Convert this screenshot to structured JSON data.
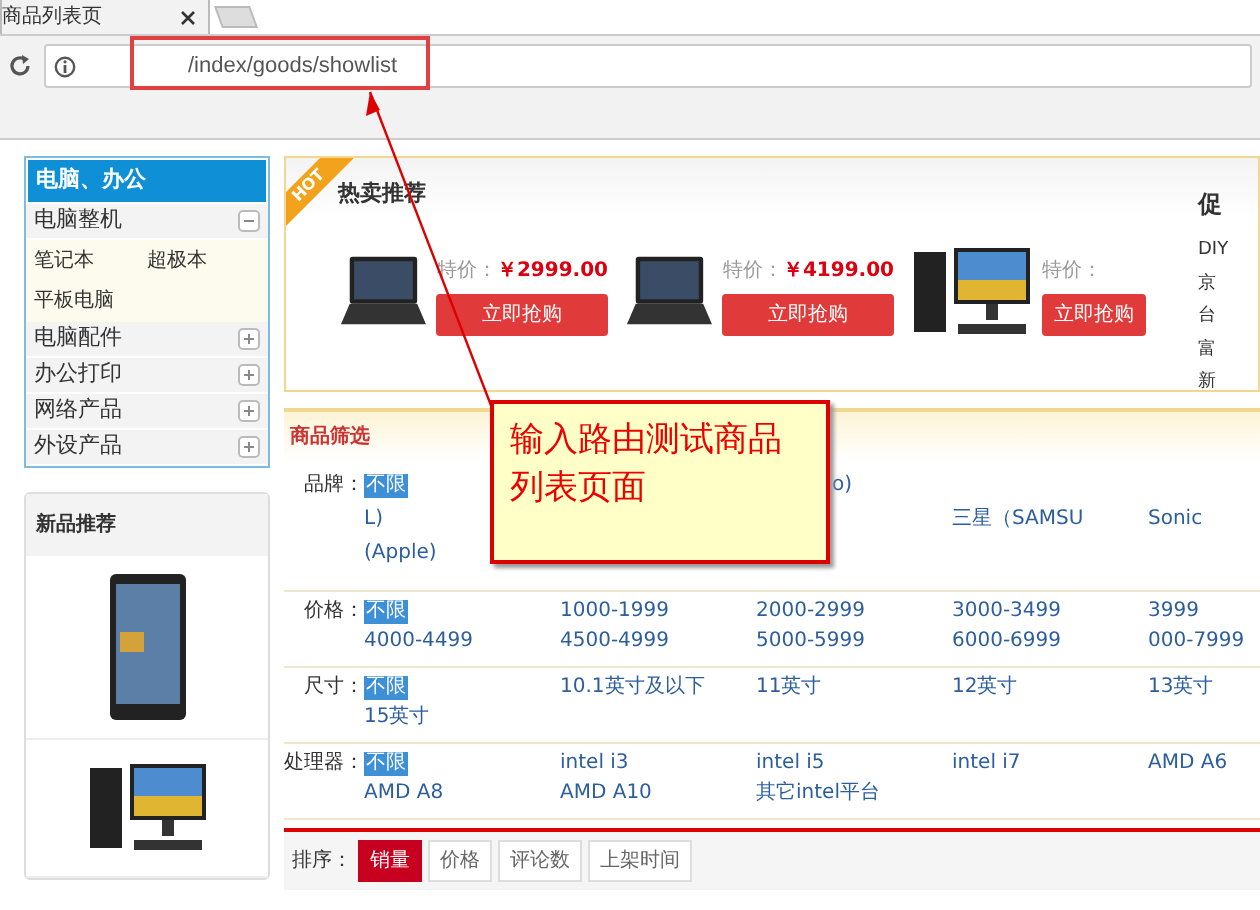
{
  "browser": {
    "tab_title": "商品列表页",
    "url": "/index/goods/showlist"
  },
  "annotation": {
    "text": "输入路由测试商品列表页面"
  },
  "sidebar": {
    "header": "电脑、办公",
    "categories": [
      {
        "label": "电脑整机",
        "expanded": true,
        "children": [
          "笔记本",
          "超极本",
          "平板电脑"
        ]
      },
      {
        "label": "电脑配件",
        "expanded": false
      },
      {
        "label": "办公打印",
        "expanded": false
      },
      {
        "label": "网络产品",
        "expanded": false
      },
      {
        "label": "外设产品",
        "expanded": false
      }
    ],
    "new_products": {
      "title": "新品推荐",
      "items": [
        {
          "kind": "tablet"
        },
        {
          "kind": "desktop"
        }
      ]
    }
  },
  "hot": {
    "badge": "HOT",
    "title": "热卖推荐",
    "products": [
      {
        "kind": "laptop",
        "price_label": "特价：",
        "price": "￥2999.00",
        "button": "立即抢购"
      },
      {
        "kind": "laptop",
        "price_label": "特价：",
        "price": "￥4199.00",
        "button": "立即抢购"
      },
      {
        "kind": "desktop",
        "price_label": "特价：",
        "button": "立即抢购"
      }
    ],
    "promo": {
      "title": "促",
      "items": [
        "DIY",
        "京",
        "台",
        "富",
        "新"
      ]
    }
  },
  "filter": {
    "title": "商品筛选",
    "rows": [
      {
        "label": "品牌：",
        "options": [
          {
            "text": "不限",
            "selected": true
          },
          {
            "text": "L)",
            "selected": false
          },
          {
            "text": "(Apple)",
            "selected": false
          },
          {
            "text": "o)",
            "selected": false
          },
          {
            "text": "三星（SAMSU",
            "selected": false
          },
          {
            "text": "Sonic",
            "selected": false
          }
        ]
      },
      {
        "label": "价格：",
        "options": [
          {
            "text": "不限",
            "selected": true
          },
          {
            "text": "1000-1999",
            "selected": false
          },
          {
            "text": "2000-2999",
            "selected": false
          },
          {
            "text": "3000-3499",
            "selected": false
          },
          {
            "text": "3999",
            "selected": false
          },
          {
            "text": "4000-4499",
            "selected": false
          },
          {
            "text": "4500-4999",
            "selected": false
          },
          {
            "text": "5000-5999",
            "selected": false
          },
          {
            "text": "6000-6999",
            "selected": false
          },
          {
            "text": "000-7999",
            "selected": false
          }
        ]
      },
      {
        "label": "尺寸：",
        "options": [
          {
            "text": "不限",
            "selected": true
          },
          {
            "text": "10.1英寸及以下",
            "selected": false
          },
          {
            "text": "11英寸",
            "selected": false
          },
          {
            "text": "12英寸",
            "selected": false
          },
          {
            "text": "13英寸",
            "selected": false
          },
          {
            "text": "15英寸",
            "selected": false
          }
        ]
      },
      {
        "label": "处理器：",
        "options": [
          {
            "text": "不限",
            "selected": true
          },
          {
            "text": "intel i3",
            "selected": false
          },
          {
            "text": "intel i5",
            "selected": false
          },
          {
            "text": "intel i7",
            "selected": false
          },
          {
            "text": "AMD A6",
            "selected": false
          },
          {
            "text": "AMD A8",
            "selected": false
          },
          {
            "text": "AMD A10",
            "selected": false
          },
          {
            "text": "其它intel平台",
            "selected": false
          }
        ]
      }
    ]
  },
  "sort": {
    "label": "排序：",
    "options": [
      {
        "text": "销量",
        "selected": true
      },
      {
        "text": "价格",
        "selected": false
      },
      {
        "text": "评论数",
        "selected": false
      },
      {
        "text": "上架时间",
        "selected": false
      }
    ]
  }
}
